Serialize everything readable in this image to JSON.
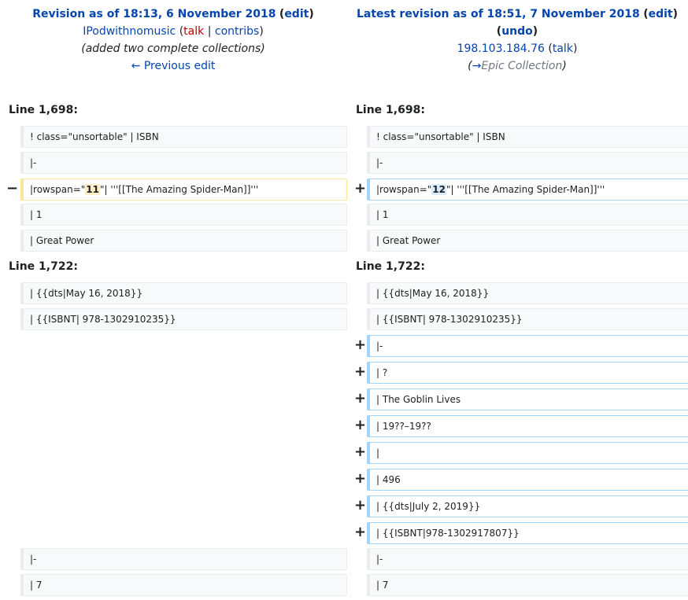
{
  "left_header": {
    "title": "Revision as of 18:13, 6 November 2018",
    "edit": "edit",
    "user": "IPodwithnomusic",
    "talk": "talk",
    "sep": "|",
    "contribs": "contribs",
    "summary": "(added two complete collections)",
    "prev_edit": "← Previous edit"
  },
  "right_header": {
    "title": "Latest revision as of 18:51, 7 November 2018",
    "edit": "edit",
    "undo": "undo",
    "user": "198.103.184.76",
    "talk": "talk",
    "summary_arrow": "→",
    "summary_section": "Epic Collection"
  },
  "sections": [
    {
      "label": "Line 1,698:"
    },
    {
      "label": "Line 1,722:"
    }
  ],
  "markers": {
    "minus": "−",
    "plus": "+"
  },
  "diff": {
    "s1": {
      "ctx1": "! class=\"unsortable\" | ISBN",
      "ctx2": "|-",
      "changed_left_pre": "|rowspan=\"",
      "changed_left_mark": "11",
      "changed_right_mark": "12",
      "changed_post": "\"| '''[[The Amazing Spider-Man]]'''",
      "ctx3": "| 1",
      "ctx4": "| Great Power"
    },
    "s2": {
      "ctx1": "| {{dts|May 16, 2018}}",
      "ctx2": "| {{ISBNT| 978-1302910235}}",
      "added": [
        "|-",
        "| ?",
        "| The Goblin Lives",
        "| 19??–19??",
        "|",
        "| 496",
        "| {{dts|July 2, 2019}}",
        "| {{ISBNT|978-1302917807}}"
      ],
      "ctx3": "|-",
      "ctx4": "| 7"
    }
  }
}
